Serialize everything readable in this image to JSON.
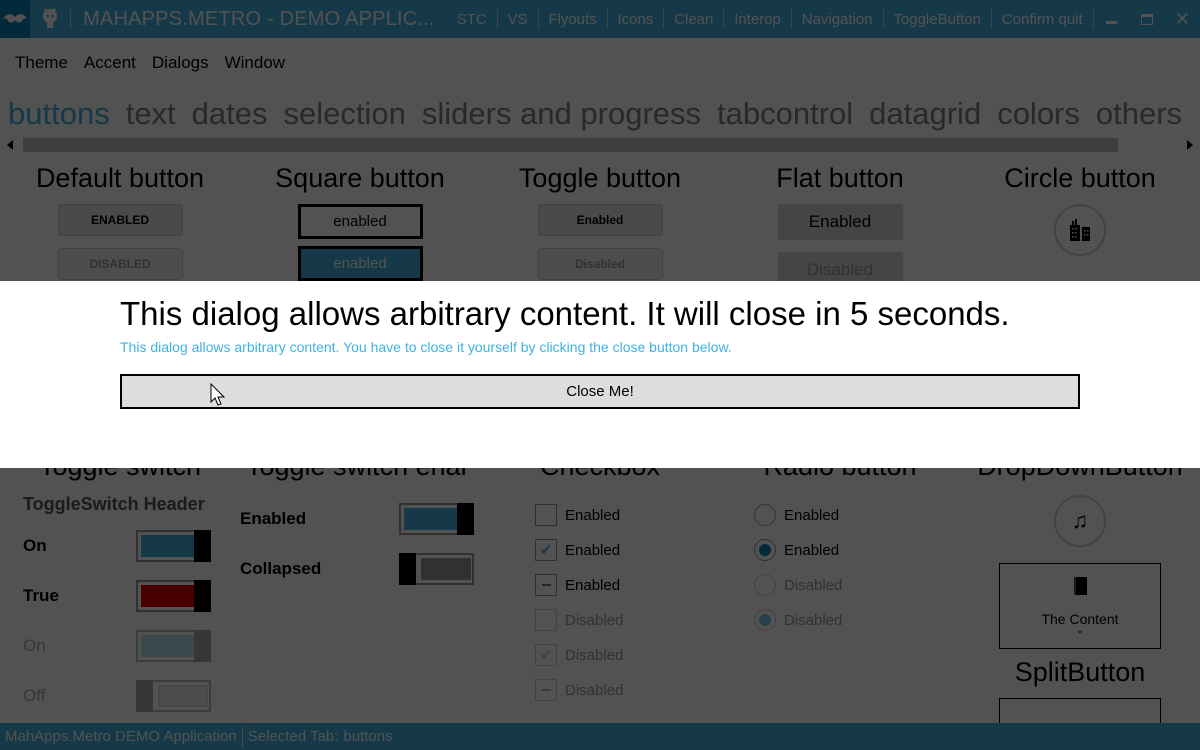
{
  "window": {
    "title": "MAHAPPS.METRO - DEMO APPLIC...",
    "commands": [
      "STC",
      "VS",
      "Flyouts",
      "Icons",
      "Clean",
      "Interop",
      "Navigation",
      "ToggleButton",
      "Confirm quit"
    ],
    "logo_icon": "mustache-icon",
    "github_icon": "github-octocat-icon",
    "controls": [
      "minimize",
      "maximize",
      "close"
    ]
  },
  "colors": {
    "accent": "#41b1e1",
    "accent_dark": "#0f7fb6",
    "overlay": "#000000",
    "toggle_red": "#c00000"
  },
  "menu": [
    "Theme",
    "Accent",
    "Dialogs",
    "Window"
  ],
  "tabs": {
    "items": [
      "buttons",
      "text",
      "dates",
      "selection",
      "sliders and progress",
      "tabcontrol",
      "datagrid",
      "colors",
      "others"
    ],
    "selected": "buttons"
  },
  "sections": {
    "default_button": {
      "header": "Default button",
      "enabled": "ENABLED",
      "disabled": "DISABLED"
    },
    "square_button": {
      "header": "Square button",
      "enabled": "enabled",
      "enabled_accent": "enabled"
    },
    "toggle_button": {
      "header": "Toggle button",
      "enabled": "Enabled",
      "disabled": "Disabled"
    },
    "flat_button": {
      "header": "Flat button",
      "enabled": "Enabled",
      "disabled": "Disabled"
    },
    "circle_button": {
      "header": "Circle button",
      "icon": "city-buildings-icon"
    },
    "toggle_switch": {
      "header": "Toggle switch",
      "group_header": "ToggleSwitch Header",
      "items": [
        {
          "label": "On",
          "state": true,
          "enabled": true,
          "color": "accent"
        },
        {
          "label": "True",
          "state": true,
          "enabled": true,
          "color": "red"
        },
        {
          "label": "On",
          "state": true,
          "enabled": false,
          "color": "accent"
        },
        {
          "label": "Off",
          "state": false,
          "enabled": false,
          "color": "gray"
        }
      ]
    },
    "toggle_switch_enabled": {
      "header": "Toggle switch enal",
      "items": [
        {
          "label": "Enabled",
          "state": true
        },
        {
          "label": "Collapsed",
          "state": false
        }
      ]
    },
    "checkbox": {
      "header": "Checkbox",
      "items": [
        {
          "label": "Enabled",
          "state": "unchecked",
          "enabled": true
        },
        {
          "label": "Enabled",
          "state": "checked",
          "enabled": true
        },
        {
          "label": "Enabled",
          "state": "indeterminate",
          "enabled": true
        },
        {
          "label": "Disabled",
          "state": "unchecked",
          "enabled": false
        },
        {
          "label": "Disabled",
          "state": "checked",
          "enabled": false
        },
        {
          "label": "Disabled",
          "state": "indeterminate",
          "enabled": false
        }
      ]
    },
    "radio": {
      "header": "Radio button",
      "items": [
        {
          "label": "Enabled",
          "checked": false,
          "enabled": true
        },
        {
          "label": "Enabled",
          "checked": true,
          "enabled": true
        },
        {
          "label": "Disabled",
          "checked": false,
          "enabled": false
        },
        {
          "label": "Disabled",
          "checked": true,
          "enabled": false
        }
      ]
    },
    "dropdown_button": {
      "header": "DropDownButton",
      "circle_icon": "music-note-icon",
      "content_icon": "notebook-icon",
      "content_label": "The Content"
    },
    "split_button": {
      "header": "SplitButton"
    }
  },
  "dialog": {
    "title": "This dialog allows arbitrary content. It will close in 5 seconds.",
    "message": "This dialog allows arbitrary content. You have to close it yourself by clicking the close button below.",
    "button": "Close Me!"
  },
  "statusbar": {
    "app": "MahApps.Metro DEMO Application",
    "selected_tab_label": "Selected Tab:",
    "selected_tab_value": "buttons"
  }
}
